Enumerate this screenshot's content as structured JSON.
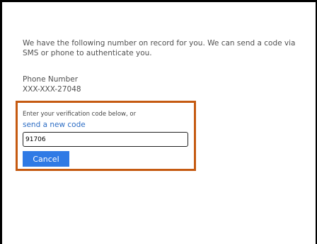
{
  "auth": {
    "intro_text": "We have the following number on record for you. We can send a code via SMS or phone to authenticate you.",
    "phone_label": "Phone Number",
    "phone_value": "XXX-XXX-27048"
  },
  "verification": {
    "prompt": "Enter your verification code below, or",
    "new_code_link": "send a new code",
    "code_value": "91706",
    "cancel_label": "Cancel"
  },
  "colors": {
    "highlight_border": "#c55a11",
    "button_bg": "#2f7ae5",
    "link": "#2b6cc4"
  }
}
